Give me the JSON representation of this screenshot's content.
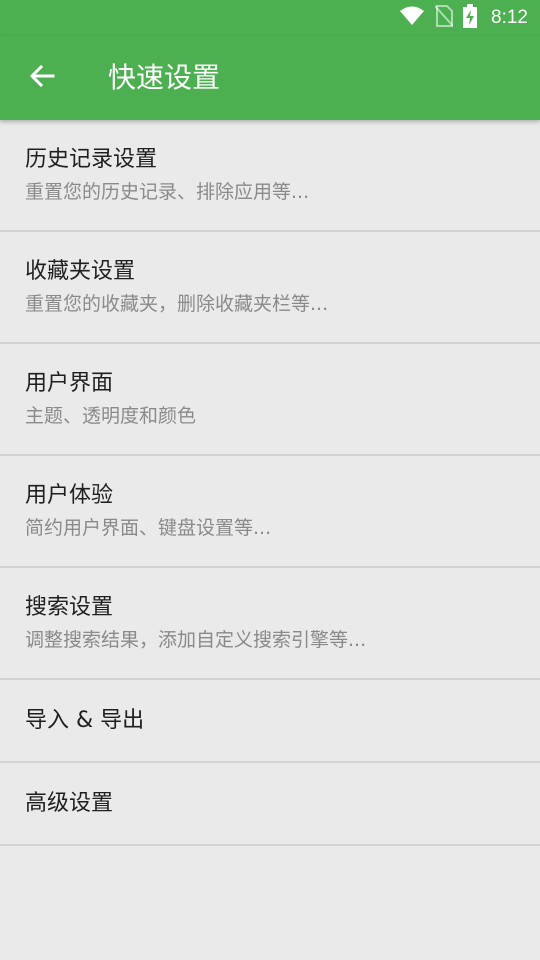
{
  "status_bar": {
    "time": "8:12",
    "icons": [
      "wifi-icon",
      "no-sim-icon",
      "battery-charging-icon"
    ]
  },
  "app_bar": {
    "back_icon": "arrow-left-icon",
    "title": "快速设置"
  },
  "settings": [
    {
      "title": "历史记录设置",
      "subtitle": "重置您的历史记录、排除应用等..."
    },
    {
      "title": "收藏夹设置",
      "subtitle": "重置您的收藏夹，删除收藏夹栏等..."
    },
    {
      "title": "用户界面",
      "subtitle": "主题、透明度和颜色"
    },
    {
      "title": "用户体验",
      "subtitle": "简约用户界面、键盘设置等..."
    },
    {
      "title": "搜索设置",
      "subtitle": "调整搜索结果，添加自定义搜索引擎等..."
    },
    {
      "title": "导入 & 导出"
    },
    {
      "title": "高级设置"
    }
  ],
  "colors": {
    "accent": "#4caf50",
    "background": "#eaeaea",
    "divider": "#d3d3d3",
    "title_text": "#1f1f1f",
    "subtitle_text": "#8a8a8a"
  }
}
